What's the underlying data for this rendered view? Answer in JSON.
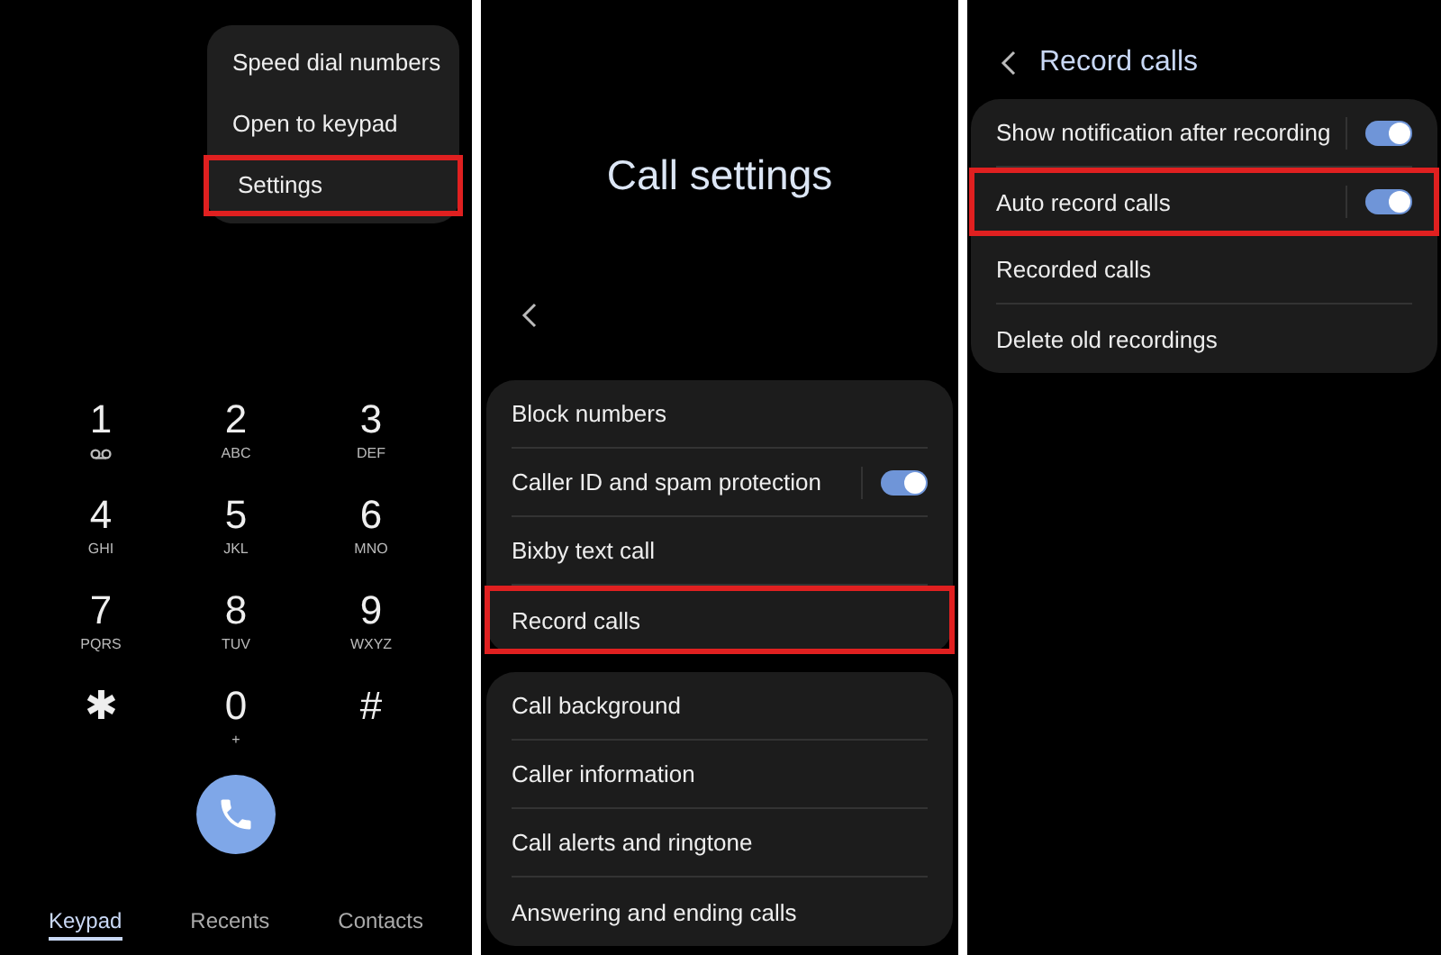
{
  "dialer": {
    "menu": [
      {
        "label": "Speed dial numbers",
        "highlighted": false
      },
      {
        "label": "Open to keypad",
        "highlighted": false
      },
      {
        "label": "Settings",
        "highlighted": true
      }
    ],
    "keys": [
      {
        "digit": "1",
        "kind": "voicemail"
      },
      {
        "digit": "2",
        "letters": "ABC",
        "kind": "letters"
      },
      {
        "digit": "3",
        "letters": "DEF",
        "kind": "letters"
      },
      {
        "digit": "4",
        "letters": "GHI",
        "kind": "letters"
      },
      {
        "digit": "5",
        "letters": "JKL",
        "kind": "letters"
      },
      {
        "digit": "6",
        "letters": "MNO",
        "kind": "letters"
      },
      {
        "digit": "7",
        "letters": "PQRS",
        "kind": "letters"
      },
      {
        "digit": "8",
        "letters": "TUV",
        "kind": "letters"
      },
      {
        "digit": "9",
        "letters": "WXYZ",
        "kind": "letters"
      },
      {
        "digit": "✱",
        "kind": "plain"
      },
      {
        "digit": "0",
        "letters": "+",
        "kind": "letters"
      },
      {
        "digit": "#",
        "kind": "plain"
      }
    ],
    "tabs": [
      {
        "label": "Keypad",
        "selected": true
      },
      {
        "label": "Recents",
        "selected": false
      },
      {
        "label": "Contacts",
        "selected": false
      }
    ]
  },
  "call_settings": {
    "title": "Call settings",
    "groups": [
      [
        {
          "label": "Block numbers",
          "kind": "plain",
          "highlighted": false
        },
        {
          "label": "Caller ID and spam protection",
          "kind": "switch",
          "on": true,
          "highlighted": false
        },
        {
          "label": "Bixby text call",
          "kind": "plain",
          "highlighted": false
        },
        {
          "label": "Record calls",
          "kind": "plain",
          "highlighted": true
        }
      ],
      [
        {
          "label": "Call background",
          "kind": "plain",
          "highlighted": false
        },
        {
          "label": "Caller information",
          "kind": "plain",
          "highlighted": false
        },
        {
          "label": "Call alerts and ringtone",
          "kind": "plain",
          "highlighted": false
        },
        {
          "label": "Answering and ending calls",
          "kind": "plain",
          "highlighted": false
        }
      ]
    ]
  },
  "record_calls": {
    "title": "Record calls",
    "items": [
      {
        "label": "Show notification after recording",
        "kind": "switch",
        "on": true,
        "highlighted": false
      },
      {
        "label": "Auto record calls",
        "kind": "switch",
        "on": true,
        "highlighted": true
      },
      {
        "label": "Recorded calls",
        "kind": "plain",
        "highlighted": false
      },
      {
        "label": "Delete old recordings",
        "kind": "plain",
        "highlighted": false
      }
    ]
  }
}
